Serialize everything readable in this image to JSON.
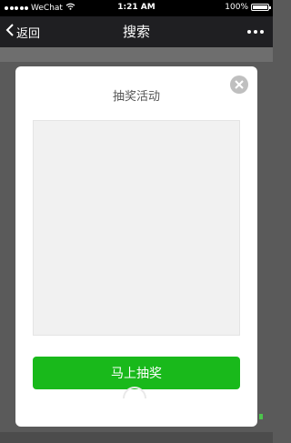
{
  "status_bar": {
    "carrier": "WeChat",
    "time": "1:21 AM",
    "battery": "100%"
  },
  "nav": {
    "back_label": "返回",
    "title": "搜索"
  },
  "modal": {
    "title": "抽奖活动",
    "button_label": "马上抽奖"
  },
  "colors": {
    "accent": "#19b91b",
    "navbar": "#1f1f22"
  }
}
